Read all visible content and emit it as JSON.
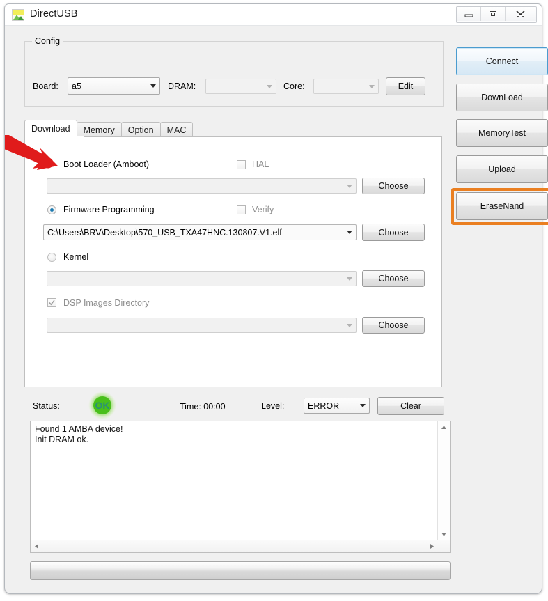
{
  "window": {
    "title": "DirectUSB",
    "icon": "app-image-icon",
    "controls": {
      "minimize": "minimize-icon",
      "maximize": "maximize-icon",
      "close": "close-icon"
    }
  },
  "config": {
    "legend": "Config",
    "board_label": "Board:",
    "board_value": "a5",
    "dram_label": "DRAM:",
    "dram_value": "",
    "core_label": "Core:",
    "core_value": "",
    "edit_label": "Edit"
  },
  "tabs": [
    {
      "label": "Download",
      "active": true
    },
    {
      "label": "Memory",
      "active": false
    },
    {
      "label": "Option",
      "active": false
    },
    {
      "label": "MAC",
      "active": false
    }
  ],
  "download_tab": {
    "bootloader": {
      "label": "Boot Loader (Amboot)",
      "selected": false,
      "path_value": "",
      "choose_label": "Choose"
    },
    "hal": {
      "label": "HAL",
      "checked": false
    },
    "firmware": {
      "label": "Firmware Programming",
      "selected": true,
      "path_value": "C:\\Users\\BRV\\Desktop\\570_USB_TXA47HNC.130807.V1.elf",
      "choose_label": "Choose"
    },
    "verify": {
      "label": "Verify",
      "checked": false
    },
    "kernel": {
      "label": "Kernel",
      "selected": false,
      "path_value": "",
      "choose_label": "Choose"
    },
    "dsp": {
      "label": "DSP Images Directory",
      "checked": true,
      "disabled": true,
      "path_value": "",
      "choose_label": "Choose"
    }
  },
  "status_bar": {
    "status_label": "Status:",
    "status_badge": "OK",
    "time_label": "Time: 00:00",
    "level_label": "Level:",
    "level_value": "ERROR",
    "clear_label": "Clear"
  },
  "log": {
    "lines": [
      "Found 1 AMBA device!",
      "Init DRAM ok."
    ],
    "text": "Found 1 AMBA device!\nInit DRAM ok."
  },
  "side_buttons": [
    {
      "label": "Connect",
      "focused": true
    },
    {
      "label": "DownLoad",
      "focused": false
    },
    {
      "label": "MemoryTest",
      "focused": false
    },
    {
      "label": "Upload",
      "focused": false
    },
    {
      "label": "EraseNand",
      "focused": false,
      "highlighted": true
    }
  ],
  "annotations": {
    "arrow_color": "#e01b1b",
    "arrow_target": "boot-loader-radio",
    "highlight_color": "#ea7f21",
    "highlight_target": "erase-nand-button"
  },
  "colors": {
    "accent_focus": "#4b9ccf",
    "annotation_red": "#e01b1b",
    "annotation_orange": "#ea7f21",
    "status_green": "#4cc417",
    "window_bg": "#f0f0f0"
  }
}
